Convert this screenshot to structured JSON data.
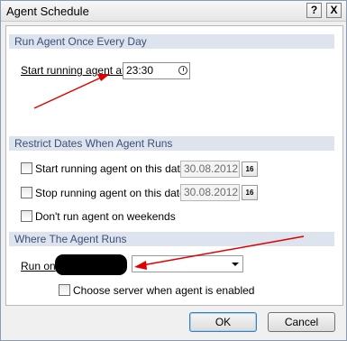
{
  "window": {
    "title": "Agent Schedule",
    "help_glyph": "?",
    "close_glyph": "X"
  },
  "sections": {
    "run_once": "Run Agent Once Every Day",
    "restrict": "Restrict Dates When Agent Runs",
    "where": "Where The Agent Runs"
  },
  "run_once": {
    "start_label": "Start running agent at",
    "start_value": "23:30"
  },
  "restrict": {
    "start_label": "Start running agent on this date",
    "start_date": "30.08.2012",
    "stop_label": "Stop running agent on this date",
    "stop_date": "30.08.2012",
    "weekends_label": "Don't run agent on weekends",
    "calendar_glyph": "16"
  },
  "where": {
    "run_on_label": "Run on",
    "run_on_value": "",
    "choose_server_label": "Choose server when agent is enabled"
  },
  "buttons": {
    "ok": "OK",
    "cancel": "Cancel"
  },
  "colors": {
    "section_header_bg": "#dde4ee",
    "section_header_text": "#3b4f77",
    "annotation_arrow": "#e00000"
  }
}
